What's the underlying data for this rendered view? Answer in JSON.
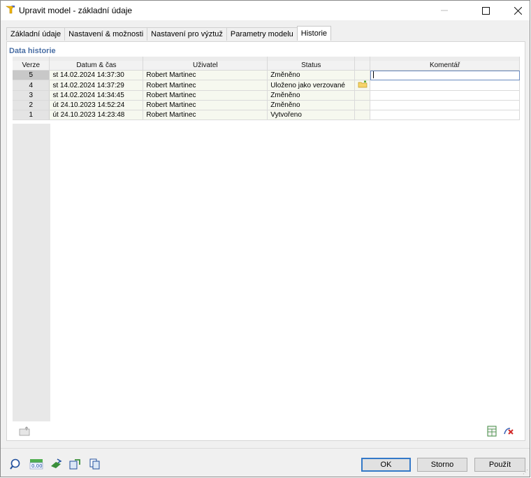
{
  "window": {
    "title": "Upravit model - základní údaje"
  },
  "tabs": [
    {
      "label": "Základní údaje",
      "active": false
    },
    {
      "label": "Nastavení & možnosti",
      "active": false
    },
    {
      "label": "Nastavení pro výztuž",
      "active": false
    },
    {
      "label": "Parametry modelu",
      "active": false
    },
    {
      "label": "Historie",
      "active": true
    }
  ],
  "section": {
    "title": "Data historie"
  },
  "table": {
    "columns": [
      "Verze",
      "Datum & čas",
      "Uživatel",
      "Status",
      "",
      "Komentář"
    ],
    "rows": [
      {
        "verze": "5",
        "datum": "st 14.02.2024 14:37:30",
        "uzivatel": "Robert Martinec",
        "status": "Změněno",
        "icon": "",
        "komentar": ""
      },
      {
        "verze": "4",
        "datum": "st 14.02.2024 14:37:29",
        "uzivatel": "Robert Martinec",
        "status": "Uloženo jako verzované",
        "icon": "folder-icon",
        "komentar": ""
      },
      {
        "verze": "3",
        "datum": "st 14.02.2024 14:34:45",
        "uzivatel": "Robert Martinec",
        "status": "Změněno",
        "icon": "",
        "komentar": ""
      },
      {
        "verze": "2",
        "datum": "út 24.10.2023 14:52:24",
        "uzivatel": "Robert Martinec",
        "status": "Změněno",
        "icon": "",
        "komentar": ""
      },
      {
        "verze": "1",
        "datum": "út 24.10.2023 14:23:48",
        "uzivatel": "Robert Martinec",
        "status": "Vytvořeno",
        "icon": "",
        "komentar": ""
      }
    ]
  },
  "buttons": {
    "ok": "OK",
    "storno": "Storno",
    "pouzit": "Použít"
  },
  "footer_icons": [
    "search-icon",
    "units-icon",
    "rotate-icon",
    "model-icon",
    "copy-icon"
  ],
  "panel_icons": [
    "export-icon",
    "table-icon",
    "delete-icon"
  ],
  "colors": {
    "accent": "#4a6fa5",
    "row_bg": "#f6f8ef",
    "ok_border": "#3479c8"
  }
}
